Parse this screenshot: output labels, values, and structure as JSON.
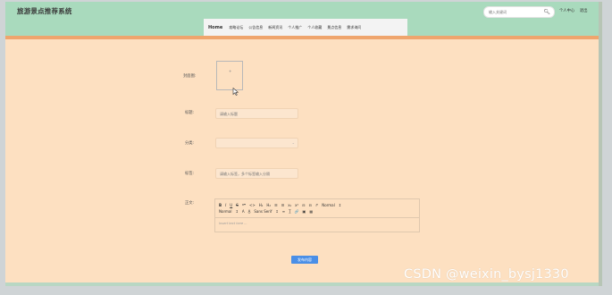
{
  "header": {
    "title": "旅游景点推荐系统",
    "search_placeholder": "输入关键词",
    "search_icon": "search-icon",
    "user_center": "个人中心",
    "logout": "退出"
  },
  "nav": {
    "items": [
      "Home",
      "攻略论坛",
      "公告信息",
      "新闻资讯",
      "个人推广",
      "个人收藏",
      "景点信息",
      "需求询问"
    ]
  },
  "form": {
    "cover_label": "封面图:",
    "title_label": "标题:",
    "title_placeholder": "请输入标题",
    "category_label": "分类:",
    "tags_label": "标签:",
    "tags_placeholder": "请输入标签，多个标签输入分隔",
    "content_label": "正文:"
  },
  "editor": {
    "row1": [
      "B",
      "I",
      "U",
      "S",
      "❝❞",
      "<>",
      "H₁",
      "H₂",
      "☰",
      "☰",
      "x₁",
      "x²",
      "⊟",
      "⊟",
      "↱",
      "Normal",
      "↕"
    ],
    "row2": [
      "Normal",
      "↕",
      "A",
      "A̲",
      "Sans Serif",
      "↕",
      "≡",
      "T̲",
      "🔗",
      "▣",
      "▦"
    ],
    "placeholder": "Insert text here ..."
  },
  "submit_label": "发布内容",
  "watermark": "CSDN @weixin_bysj1330",
  "colors": {
    "header_bg": "#a9dabd",
    "accent_strip": "#efa56d",
    "page_bg": "#fde0c1",
    "button": "#4a8fe7"
  }
}
